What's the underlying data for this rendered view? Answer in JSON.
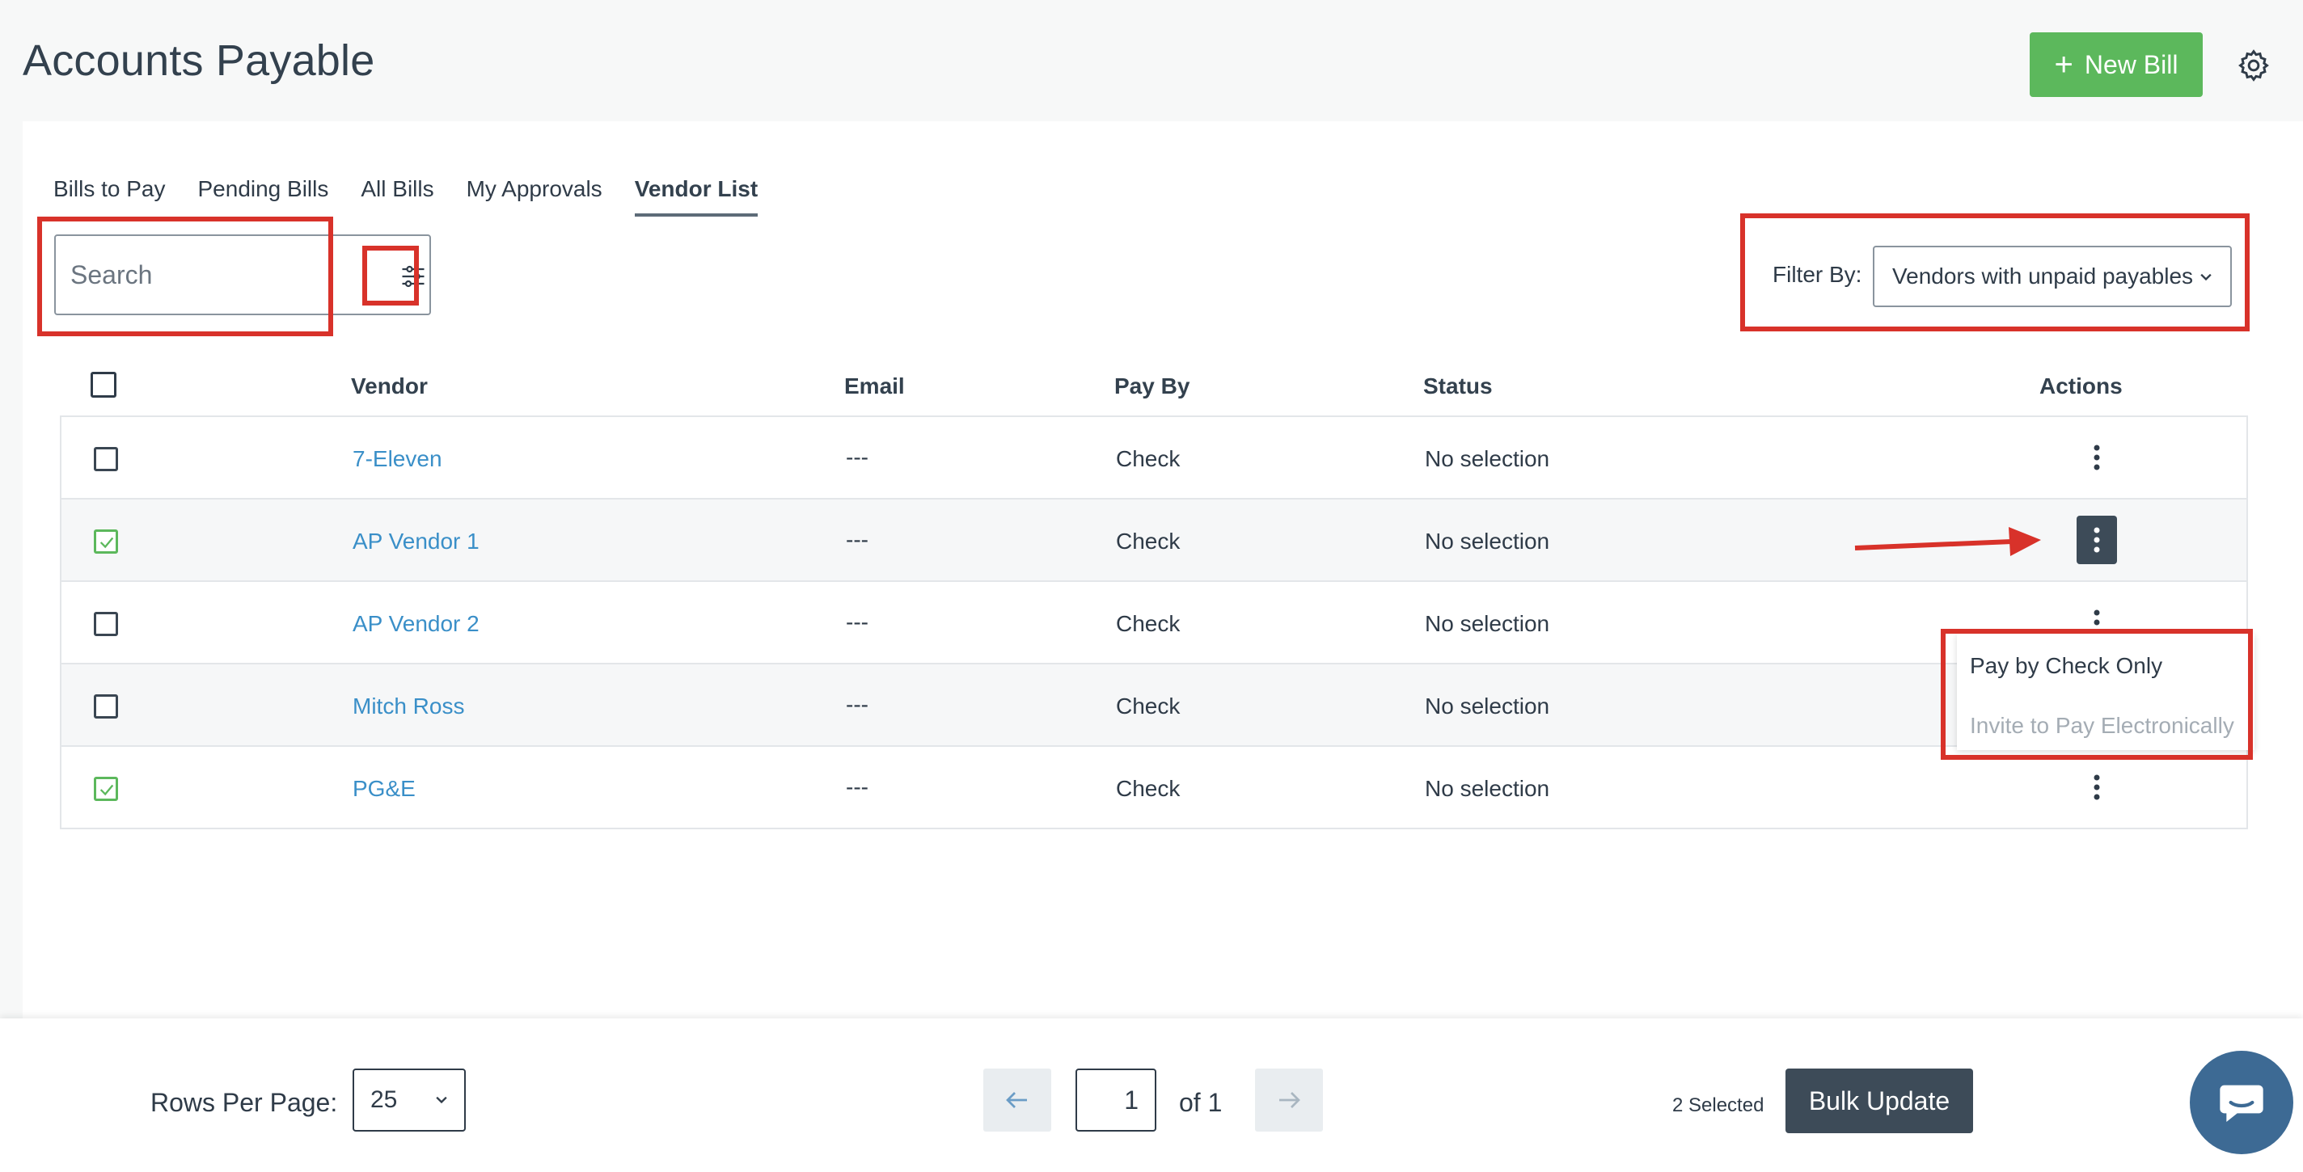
{
  "header": {
    "title": "Accounts Payable",
    "new_bill_label": "New Bill",
    "new_bill_icon": "plus-icon",
    "settings_icon": "gear-icon"
  },
  "tabs": [
    {
      "label": "Bills to Pay",
      "active": false
    },
    {
      "label": "Pending Bills",
      "active": false
    },
    {
      "label": "All Bills",
      "active": false
    },
    {
      "label": "My Approvals",
      "active": false
    },
    {
      "label": "Vendor List",
      "active": true
    }
  ],
  "search": {
    "placeholder": "Search",
    "filter_icon": "sliders-icon"
  },
  "filter": {
    "label": "Filter By:",
    "selected": "Vendors with unpaid payables"
  },
  "table": {
    "columns": [
      "Vendor",
      "Email",
      "Pay By",
      "Status",
      "Actions"
    ],
    "rows": [
      {
        "vendor": "7-Eleven",
        "email": "---",
        "pay_by": "Check",
        "status": "No selection",
        "checked": false
      },
      {
        "vendor": "AP Vendor 1",
        "email": "---",
        "pay_by": "Check",
        "status": "No selection",
        "checked": true
      },
      {
        "vendor": "AP Vendor 2",
        "email": "---",
        "pay_by": "Check",
        "status": "No selection",
        "checked": false
      },
      {
        "vendor": "Mitch Ross",
        "email": "---",
        "pay_by": "Check",
        "status": "No selection",
        "checked": false
      },
      {
        "vendor": "PG&E",
        "email": "---",
        "pay_by": "Check",
        "status": "No selection",
        "checked": true
      }
    ]
  },
  "actions_menu": {
    "items": [
      {
        "label": "Pay by Check Only",
        "enabled": true
      },
      {
        "label": "Invite to Pay Electronically",
        "enabled": false
      }
    ]
  },
  "footer": {
    "rows_per_page_label": "Rows Per Page:",
    "rows_per_page_value": "25",
    "page_current": "1",
    "page_of": "of 1",
    "selected_count": "2 Selected",
    "bulk_update_label": "Bulk Update"
  },
  "colors": {
    "primary_green": "#5cb85c",
    "dark_slate": "#3d4b58",
    "link_blue": "#3a8fc8",
    "annotation_red": "#d8322a"
  }
}
